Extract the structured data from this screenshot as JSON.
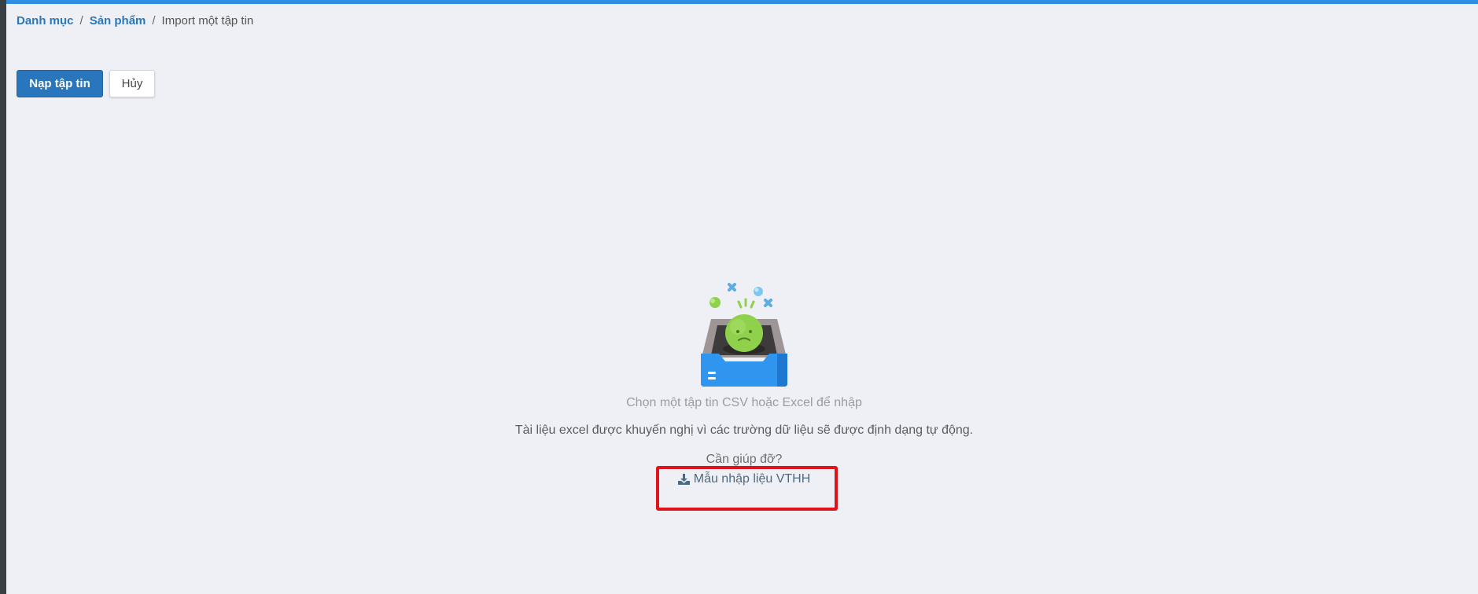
{
  "breadcrumb": {
    "items": [
      "Danh mục",
      "Sản phẩm"
    ],
    "separator": "/",
    "current": "Import một tập tin"
  },
  "toolbar": {
    "upload_label": "Nạp tập tin",
    "cancel_label": "Hủy"
  },
  "empty_state": {
    "title": "Chọn một tập tin CSV hoặc Excel để nhập",
    "description": "Tài liệu excel được khuyến nghị vì các trường dữ liệu sẽ được định dạng tự động.",
    "help_label": "Cần giúp đỡ?",
    "template_link_label": "Mẫu nhập liệu VTHH",
    "template_icon": "download-icon",
    "illustration_icon": "empty-inbox-sad-face-icon"
  },
  "colors": {
    "top_bar": "#2f8de4",
    "primary": "#2a76bc",
    "link": "#2b77b9",
    "highlight": "#e0131a",
    "background": "#eff0f5"
  }
}
